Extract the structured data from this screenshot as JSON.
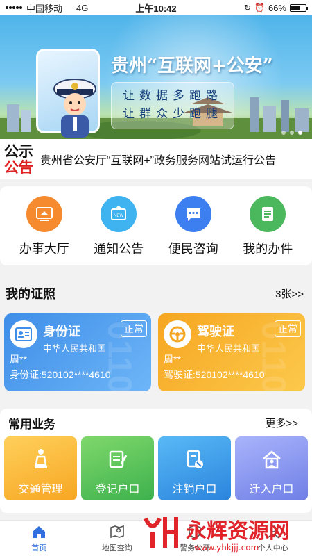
{
  "status_bar": {
    "carrier": "中国移动",
    "network": "4G",
    "time": "上午10:42",
    "battery": "66%",
    "battery_level": 0.66
  },
  "banner": {
    "title": "贵州“互联网+公安”",
    "slogan_line1": "让数据多跑路",
    "slogan_line2": "让群众少跑腿",
    "slide_count": 3,
    "active_slide": 1
  },
  "notice": {
    "logo_line1": "公示",
    "logo_line2": "公告",
    "text": "贵州省公安厅“互联网+”政务服务网站试运行公告"
  },
  "services": [
    {
      "label": "办事大厅",
      "color": "#f58a2e",
      "icon": "hall-icon"
    },
    {
      "label": "通知公告",
      "color": "#3fb3f0",
      "icon": "notice-board-icon"
    },
    {
      "label": "便民咨询",
      "color": "#3d7ff0",
      "icon": "chat-bubble-icon"
    },
    {
      "label": "我的办件",
      "color": "#4cb85d",
      "icon": "document-icon"
    }
  ],
  "certificates": {
    "heading": "我的证照",
    "count_link": "3张>>",
    "cards": [
      {
        "name": "身份证",
        "status": "正常",
        "country": "中华人民共和国",
        "holder": "周**",
        "number": "身份证:520102****4610",
        "watermark": "0110"
      },
      {
        "name": "驾驶证",
        "status": "正常",
        "country": "中华人民共和国",
        "holder": "周**",
        "number": "驾驶证:520102****4610",
        "watermark": "0110"
      }
    ]
  },
  "business": {
    "heading": "常用业务",
    "more": "更多>>",
    "items": [
      {
        "label": "交通管理",
        "icon": "traffic-icon"
      },
      {
        "label": "登记户口",
        "icon": "register-icon"
      },
      {
        "label": "注销户口",
        "icon": "cancel-icon"
      },
      {
        "label": "迁入户口",
        "icon": "move-in-icon"
      }
    ]
  },
  "tabbar": {
    "items": [
      {
        "label": "首页",
        "icon": "home-icon",
        "active": true
      },
      {
        "label": "地图查询",
        "icon": "map-icon",
        "active": false
      },
      {
        "label": "警务公开",
        "icon": "police-icon",
        "active": false
      },
      {
        "label": "个人中心",
        "icon": "user-icon",
        "active": false
      }
    ]
  },
  "site_watermark": {
    "name": "永辉资源网",
    "url": "www.yhkjjj.com"
  },
  "colors": {
    "accent": "#2f6fde",
    "notice_red": "#e02020"
  }
}
